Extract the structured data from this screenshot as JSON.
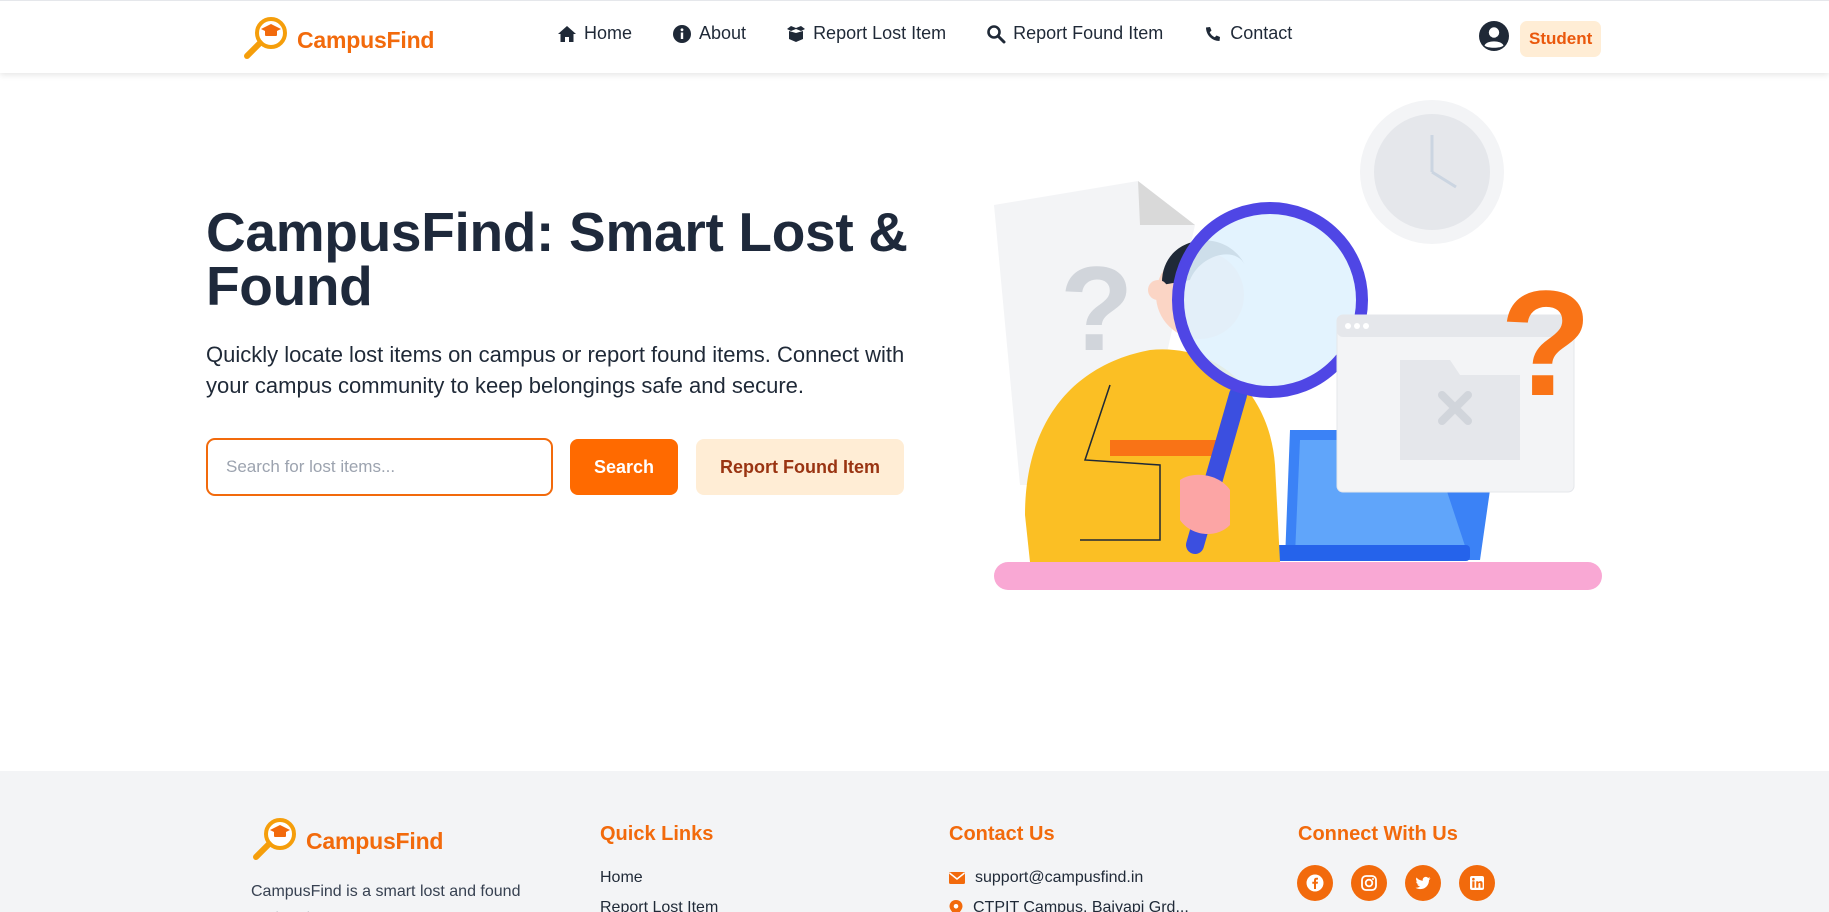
{
  "brand": {
    "name": "CampusFind",
    "color": "#f26a0c"
  },
  "nav": {
    "items": [
      {
        "label": "Home",
        "icon": "home-icon"
      },
      {
        "label": "About",
        "icon": "info-icon"
      },
      {
        "label": "Report Lost Item",
        "icon": "box-icon"
      },
      {
        "label": "Report Found Item",
        "icon": "search-icon"
      },
      {
        "label": "Contact",
        "icon": "phone-icon"
      }
    ],
    "user": {
      "icon": "user-circle-icon",
      "role": "Student"
    }
  },
  "hero": {
    "title": "CampusFind: Smart Lost & Found",
    "subtitle": "Quickly locate lost items on campus or report found items. Connect with your campus community to keep belongings safe and secure.",
    "search_placeholder": "Search for lost items...",
    "search_button": "Search",
    "report_button": "Report Found Item",
    "illustration": "person-with-magnifying-glass-illustration"
  },
  "footer": {
    "brand": "CampusFind",
    "description": "CampusFind is a smart lost and found system to ...",
    "quick_links": {
      "title": "Quick Links",
      "items": [
        "Home",
        "Report Lost Item"
      ]
    },
    "contact": {
      "title": "Contact Us",
      "email": "support@campusfind.in",
      "address": "CTPIT Campus, Baiyapi Grd..."
    },
    "social": {
      "title": "Connect With Us",
      "icons": [
        "facebook-icon",
        "instagram-icon",
        "twitter-icon",
        "linkedin-icon"
      ]
    }
  },
  "colors": {
    "accent": "#ff6a00",
    "accent_soft": "#ffedd5",
    "text_dark": "#1e293b",
    "footer_bg": "#f3f4f6"
  }
}
